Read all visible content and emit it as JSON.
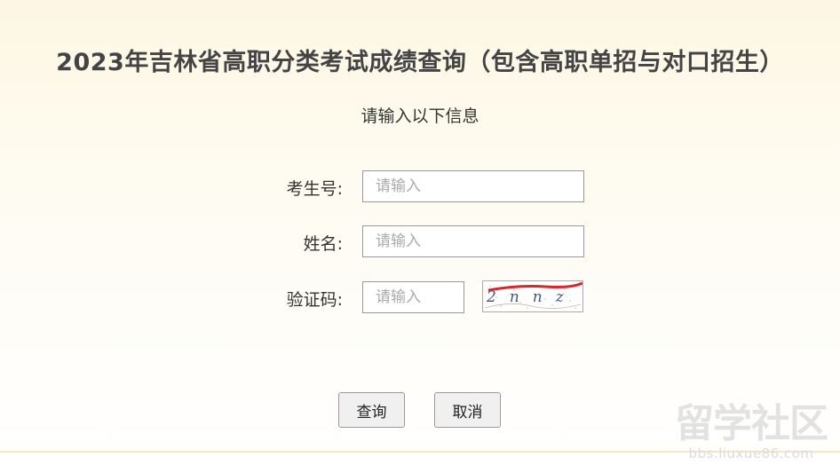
{
  "header": {
    "title": "2023年吉林省高职分类考试成绩查询（包含高职单招与对口招生）",
    "subtitle": "请输入以下信息"
  },
  "form": {
    "exam_number": {
      "label": "考生号:",
      "placeholder": "请输入",
      "value": ""
    },
    "name": {
      "label": "姓名:",
      "placeholder": "请输入",
      "value": ""
    },
    "captcha": {
      "label": "验证码:",
      "placeholder": "请输入",
      "value": "",
      "image_text": "2nnz"
    }
  },
  "buttons": {
    "query": "查询",
    "cancel": "取消"
  },
  "watermark": {
    "main": "留学社区",
    "sub": "bbs.liuxue86.com"
  },
  "colors": {
    "background_top": "#fdf6e3",
    "captcha_strike": "#d9262c",
    "captcha_text": "#3a5a8a"
  }
}
